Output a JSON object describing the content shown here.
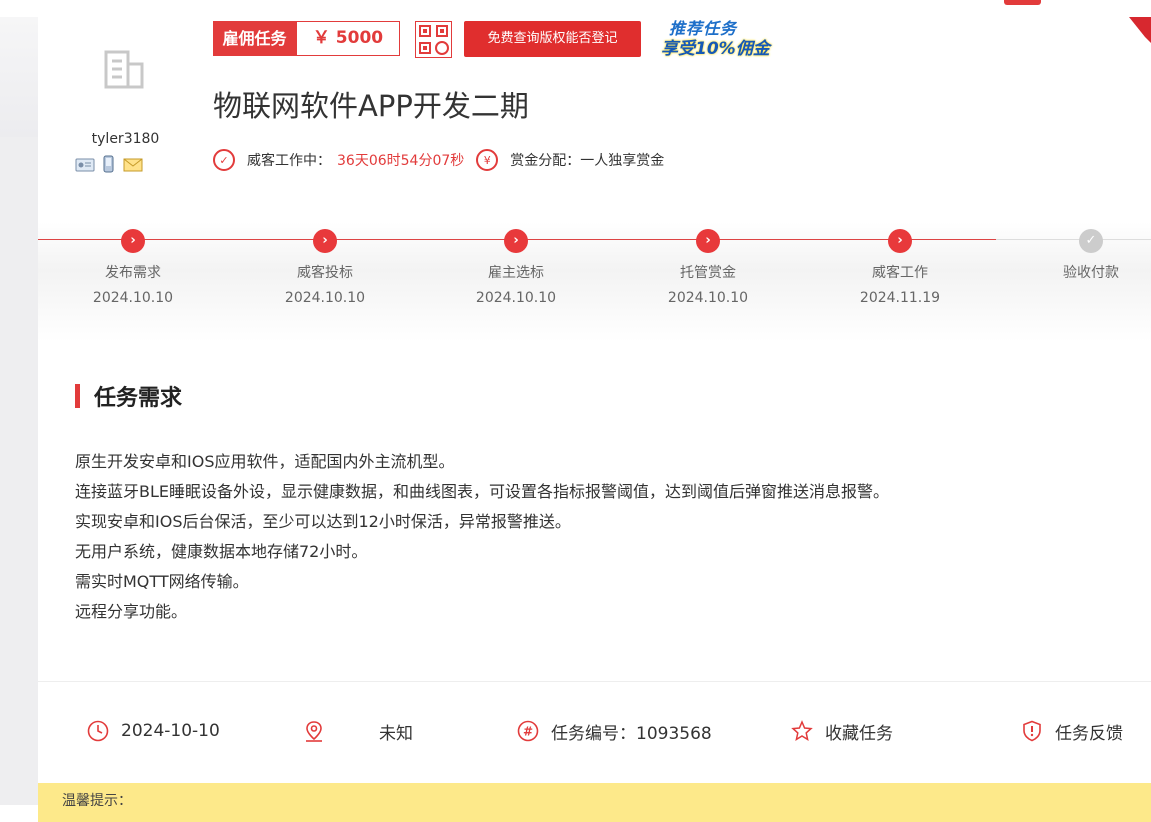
{
  "user": {
    "name": "tyler3180"
  },
  "task": {
    "type_label": "雇佣任务",
    "price": "￥ 5000",
    "copyright_button": "免费查询版权能否登记",
    "promo_line1": "推荐任务",
    "promo_line2": "享受10%佣金",
    "title": "物联网软件APP开发二期",
    "status_label": "威客工作中：",
    "countdown": "36天06时54分07秒",
    "reward_label": "赏金分配：一人独享赏金"
  },
  "steps": [
    {
      "label": "发布需求",
      "date": "2024.10.10",
      "done": true
    },
    {
      "label": "威客投标",
      "date": "2024.10.10",
      "done": true
    },
    {
      "label": "雇主选标",
      "date": "2024.10.10",
      "done": true
    },
    {
      "label": "托管赏金",
      "date": "2024.10.10",
      "done": true
    },
    {
      "label": "威客工作",
      "date": "2024.11.19",
      "done": true
    },
    {
      "label": "验收付款",
      "date": "",
      "done": false
    }
  ],
  "requirements": {
    "heading": "任务需求",
    "lines": [
      "原生开发安卓和IOS应用软件，适配国内外主流机型。",
      "连接蓝牙BLE睡眠设备外设，显示健康数据，和曲线图表，可设置各指标报警阈值，达到阈值后弹窗推送消息报警。",
      "实现安卓和IOS后台保活，至少可以达到12小时保活，异常报警推送。",
      "无用户系统，健康数据本地存储72小时。",
      "需实时MQTT网络传输。",
      "远程分享功能。"
    ]
  },
  "info": {
    "date": "2024-10-10",
    "location": "未知",
    "task_no": "任务编号：1093568",
    "favorite": "收藏任务",
    "feedback": "任务反馈"
  },
  "notice": {
    "label": "温馨提示："
  },
  "colors": {
    "accent": "#e23b3b",
    "notice_bg": "#fde98a"
  }
}
